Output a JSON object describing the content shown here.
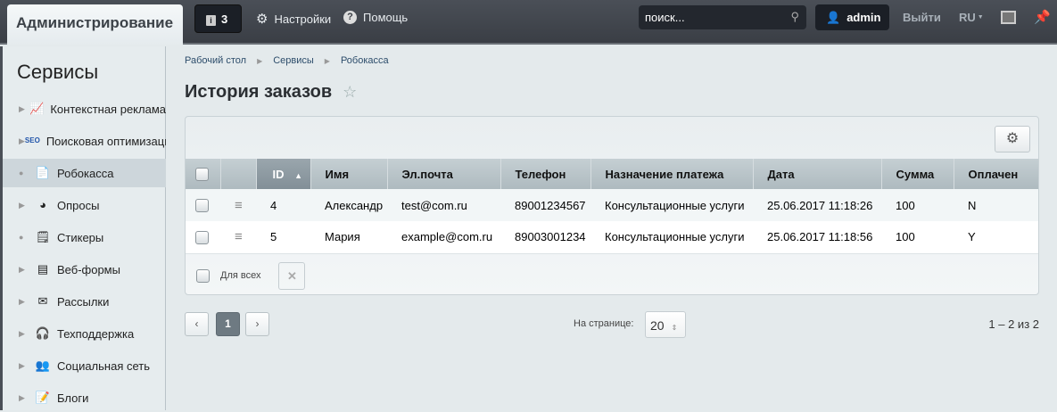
{
  "topbar": {
    "admin_tab": "Администрирование",
    "notifications_count": "3",
    "settings": "Настройки",
    "help": "Помощь",
    "search_placeholder": "поиск...",
    "user": "admin",
    "logout": "Выйти",
    "lang": "RU"
  },
  "sidebar": {
    "title": "Сервисы",
    "items": [
      {
        "label": "Контекстная реклама",
        "icon": "chart-icon",
        "glyph": "📈",
        "expandable": true
      },
      {
        "label": "Поисковая оптимизация",
        "icon": "seo-icon",
        "glyph": "SEO",
        "expandable": true
      },
      {
        "label": "Робокасса",
        "icon": "document-icon",
        "glyph": "📄",
        "expandable": false,
        "selected": true
      },
      {
        "label": "Опросы",
        "icon": "pie-chart-icon",
        "glyph": "◕",
        "expandable": true
      },
      {
        "label": "Стикеры",
        "icon": "sticker-icon",
        "glyph": "🗒",
        "expandable": false
      },
      {
        "label": "Веб-формы",
        "icon": "form-icon",
        "glyph": "▤",
        "expandable": true
      },
      {
        "label": "Рассылки",
        "icon": "mail-icon",
        "glyph": "✉",
        "expandable": true
      },
      {
        "label": "Техподдержка",
        "icon": "headset-icon",
        "glyph": "🎧",
        "expandable": true
      },
      {
        "label": "Социальная сеть",
        "icon": "people-icon",
        "glyph": "👥",
        "expandable": true
      },
      {
        "label": "Блоги",
        "icon": "blog-icon",
        "glyph": "📝",
        "expandable": true
      }
    ]
  },
  "breadcrumb": [
    "Рабочий стол",
    "Сервисы",
    "Робокасса"
  ],
  "page_title": "История заказов",
  "table": {
    "columns": [
      "ID",
      "Имя",
      "Эл.почта",
      "Телефон",
      "Назначение платежа",
      "Дата",
      "Сумма",
      "Оплачен"
    ],
    "rows": [
      [
        "4",
        "Александр",
        "test@com.ru",
        "89001234567",
        "Консультационные услуги",
        "25.06.2017 11:18:26",
        "100",
        "N"
      ],
      [
        "5",
        "Мария",
        "example@com.ru",
        "89003001234",
        "Консультационные услуги",
        "25.06.2017 11:18:56",
        "100",
        "Y"
      ]
    ],
    "for_all": "Для всех"
  },
  "pagination": {
    "current_page": "1",
    "per_page_label": "На странице:",
    "per_page": "20",
    "range": "1 – 2 из 2"
  }
}
